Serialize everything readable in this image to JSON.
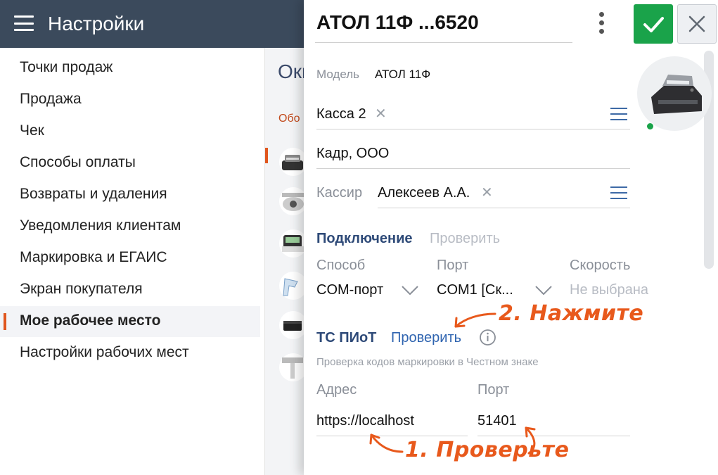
{
  "header": {
    "title": "Настройки",
    "menu_icon": "hamburger-icon"
  },
  "sidebar": {
    "items": [
      {
        "label": "Точки продаж",
        "active": false
      },
      {
        "label": "Продажа",
        "active": false
      },
      {
        "label": "Чек",
        "active": false
      },
      {
        "label": "Способы оплаты",
        "active": false
      },
      {
        "label": "Возвраты и удаления",
        "active": false
      },
      {
        "label": "Уведомления клиентам",
        "active": false
      },
      {
        "label": "Маркировка и ЕГАИС",
        "active": false
      },
      {
        "label": "Экран покупателя",
        "active": false
      },
      {
        "label": "Мое рабочее место",
        "active": true
      },
      {
        "label": "Настройки рабочих мест",
        "active": false
      }
    ]
  },
  "background_page": {
    "title": "Окн",
    "subtitle": "Обо"
  },
  "panel": {
    "title": "АТОЛ 11Ф ...6520",
    "model_label": "Модель",
    "model_value": "АТОЛ 11Ф",
    "cash_register": "Касса 2",
    "company": "Кадр, ООО",
    "cashier_label": "Кассир",
    "cashier_value": "Алексеев А.А.",
    "connection": {
      "title": "Подключение",
      "check": "Проверить",
      "method_label": "Способ",
      "method_value": "COM-порт",
      "port_label": "Порт",
      "port_value": "COM1 [Ск...",
      "speed_label": "Скорость",
      "speed_value": "Не выбрана"
    },
    "ts_piot": {
      "title": "ТС ПИоТ",
      "check": "Проверить",
      "description": "Проверка кодов маркировки в Честном знаке",
      "address_label": "Адрес",
      "address_value": "https://localhost",
      "port_label": "Порт",
      "port_value": "51401"
    },
    "status_color": "#1aa34a",
    "accent_color": "#1aa34a"
  },
  "annotations": {
    "step1": "1. Проверьте",
    "step2": "2. Нажмите",
    "color": "#e8591c"
  }
}
